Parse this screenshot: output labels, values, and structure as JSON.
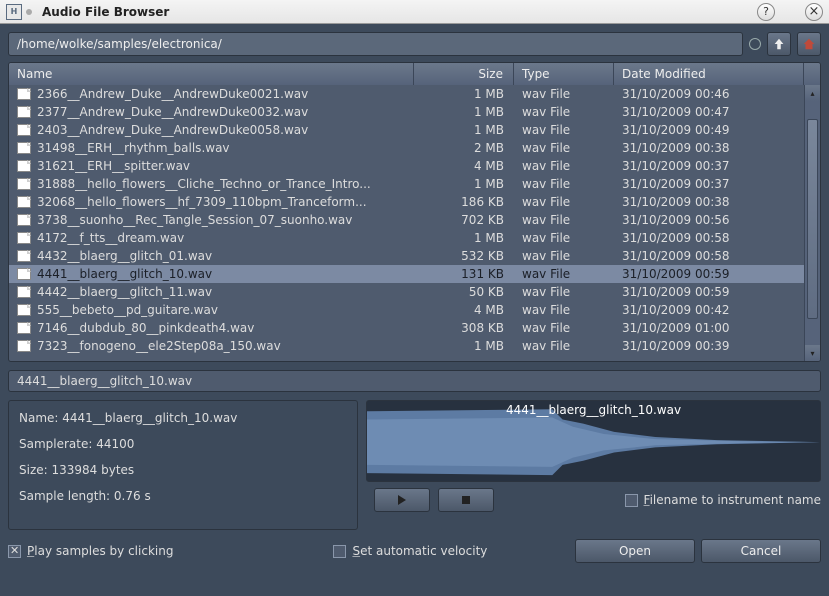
{
  "window": {
    "title": "Audio File Browser",
    "help_icon": "?",
    "close_icon": "×"
  },
  "path": "/home/wolke/samples/electronica/",
  "columns": {
    "name": "Name",
    "size": "Size",
    "type": "Type",
    "date": "Date Modified"
  },
  "rows": [
    {
      "name": "2366__Andrew_Duke__AndrewDuke0021.wav",
      "size": "1 MB",
      "type": "wav File",
      "date": "31/10/2009 00:46",
      "selected": false
    },
    {
      "name": "2377__Andrew_Duke__AndrewDuke0032.wav",
      "size": "1 MB",
      "type": "wav File",
      "date": "31/10/2009 00:47",
      "selected": false
    },
    {
      "name": "2403__Andrew_Duke__AndrewDuke0058.wav",
      "size": "1 MB",
      "type": "wav File",
      "date": "31/10/2009 00:49",
      "selected": false
    },
    {
      "name": "31498__ERH__rhythm_balls.wav",
      "size": "2 MB",
      "type": "wav File",
      "date": "31/10/2009 00:38",
      "selected": false
    },
    {
      "name": "31621__ERH__spitter.wav",
      "size": "4 MB",
      "type": "wav File",
      "date": "31/10/2009 00:37",
      "selected": false
    },
    {
      "name": "31888__hello_flowers__Cliche_Techno_or_Trance_Intro...",
      "size": "1 MB",
      "type": "wav File",
      "date": "31/10/2009 00:37",
      "selected": false
    },
    {
      "name": "32068__hello_flowers__hf_7309_110bpm_Tranceform...",
      "size": "186 KB",
      "type": "wav File",
      "date": "31/10/2009 00:38",
      "selected": false
    },
    {
      "name": "3738__suonho__Rec_Tangle_Session_07_suonho.wav",
      "size": "702 KB",
      "type": "wav File",
      "date": "31/10/2009 00:56",
      "selected": false
    },
    {
      "name": "4172__f_tts__dream.wav",
      "size": "1 MB",
      "type": "wav File",
      "date": "31/10/2009 00:58",
      "selected": false
    },
    {
      "name": "4432__blaerg__glitch_01.wav",
      "size": "532 KB",
      "type": "wav File",
      "date": "31/10/2009 00:58",
      "selected": false
    },
    {
      "name": "4441__blaerg__glitch_10.wav",
      "size": "131 KB",
      "type": "wav File",
      "date": "31/10/2009 00:59",
      "selected": true
    },
    {
      "name": "4442__blaerg__glitch_11.wav",
      "size": "50 KB",
      "type": "wav File",
      "date": "31/10/2009 00:59",
      "selected": false
    },
    {
      "name": "555__bebeto__pd_guitare.wav",
      "size": "4 MB",
      "type": "wav File",
      "date": "31/10/2009 00:42",
      "selected": false
    },
    {
      "name": "7146__dubdub_80__pinkdeath4.wav",
      "size": "308 KB",
      "type": "wav File",
      "date": "31/10/2009 01:00",
      "selected": false
    },
    {
      "name": "7323__fonogeno__ele2Step08a_150.wav",
      "size": "1 MB",
      "type": "wav File",
      "date": "31/10/2009 00:39",
      "selected": false
    }
  ],
  "selected_filename": "4441__blaerg__glitch_10.wav",
  "info": {
    "name_label": "Name: 4441__blaerg__glitch_10.wav",
    "samplerate_label": "Samplerate: 44100",
    "size_label": "Size: 133984 bytes",
    "length_label": "Sample length: 0.76 s"
  },
  "waveform_title": "4441__blaerg__glitch_10.wav",
  "checkboxes": {
    "filename_to_instrument": {
      "label_pre": "F",
      "label_post": "ilename to instrument name",
      "checked": false
    },
    "set_auto_velocity": {
      "label_pre": "S",
      "label_post": "et automatic velocity",
      "checked": false
    },
    "play_by_click": {
      "label_pre": "P",
      "label_post": "lay samples by clicking",
      "checked": true
    }
  },
  "buttons": {
    "open": "Open",
    "cancel": "Cancel"
  }
}
